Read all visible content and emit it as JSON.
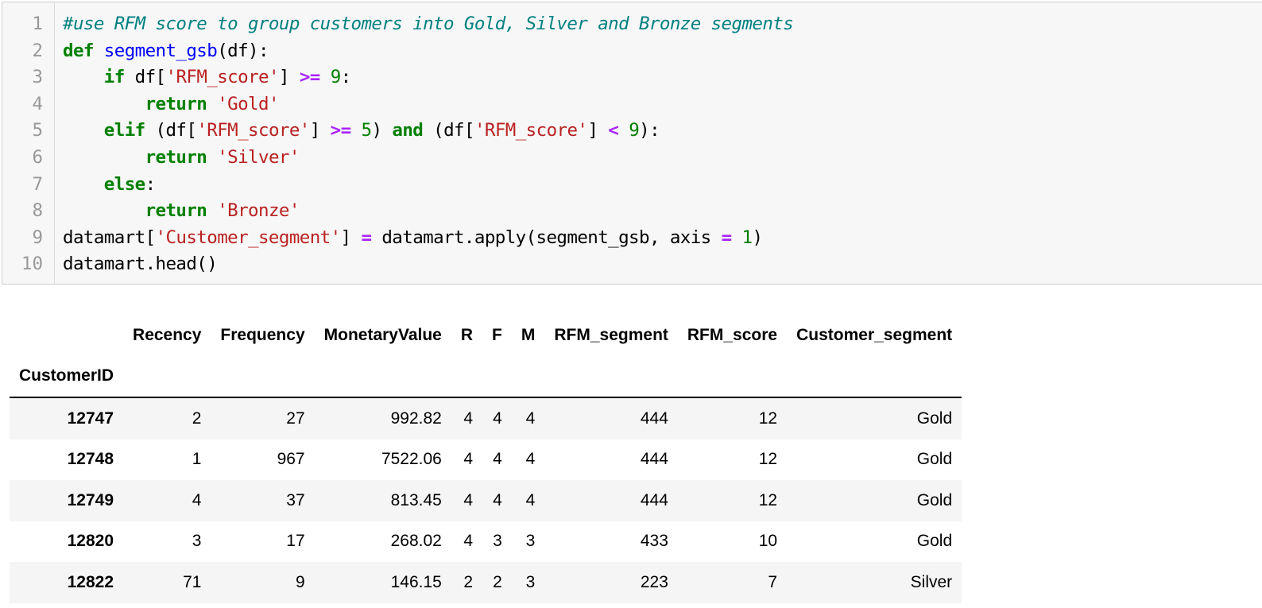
{
  "code_cell": {
    "line_numbers": [
      "1",
      "2",
      "3",
      "4",
      "5",
      "6",
      "7",
      "8",
      "9",
      "10"
    ],
    "lines": [
      [
        {
          "t": "cm",
          "v": "#use RFM score to group customers into Gold, Silver and Bronze segments"
        }
      ],
      [
        {
          "t": "kw",
          "v": "def"
        },
        {
          "t": "",
          "v": " "
        },
        {
          "t": "fn",
          "v": "segment_gsb"
        },
        {
          "t": "",
          "v": "(df):"
        }
      ],
      [
        {
          "t": "",
          "v": "    "
        },
        {
          "t": "kw",
          "v": "if"
        },
        {
          "t": "",
          "v": " df["
        },
        {
          "t": "st",
          "v": "'RFM_score'"
        },
        {
          "t": "",
          "v": "] "
        },
        {
          "t": "op",
          "v": ">="
        },
        {
          "t": "",
          "v": " "
        },
        {
          "t": "nu",
          "v": "9"
        },
        {
          "t": "",
          "v": ":"
        }
      ],
      [
        {
          "t": "",
          "v": "        "
        },
        {
          "t": "kw",
          "v": "return"
        },
        {
          "t": "",
          "v": " "
        },
        {
          "t": "st",
          "v": "'Gold'"
        }
      ],
      [
        {
          "t": "",
          "v": "    "
        },
        {
          "t": "kw",
          "v": "elif"
        },
        {
          "t": "",
          "v": " (df["
        },
        {
          "t": "st",
          "v": "'RFM_score'"
        },
        {
          "t": "",
          "v": "] "
        },
        {
          "t": "op",
          "v": ">="
        },
        {
          "t": "",
          "v": " "
        },
        {
          "t": "nu",
          "v": "5"
        },
        {
          "t": "",
          "v": ") "
        },
        {
          "t": "kw",
          "v": "and"
        },
        {
          "t": "",
          "v": " (df["
        },
        {
          "t": "st",
          "v": "'RFM_score'"
        },
        {
          "t": "",
          "v": "] "
        },
        {
          "t": "op",
          "v": "<"
        },
        {
          "t": "",
          "v": " "
        },
        {
          "t": "nu",
          "v": "9"
        },
        {
          "t": "",
          "v": "):"
        }
      ],
      [
        {
          "t": "",
          "v": "        "
        },
        {
          "t": "kw",
          "v": "return"
        },
        {
          "t": "",
          "v": " "
        },
        {
          "t": "st",
          "v": "'Silver'"
        }
      ],
      [
        {
          "t": "",
          "v": "    "
        },
        {
          "t": "kw",
          "v": "else"
        },
        {
          "t": "",
          "v": ":"
        }
      ],
      [
        {
          "t": "",
          "v": "        "
        },
        {
          "t": "kw",
          "v": "return"
        },
        {
          "t": "",
          "v": " "
        },
        {
          "t": "st",
          "v": "'Bronze'"
        }
      ],
      [
        {
          "t": "",
          "v": "datamart["
        },
        {
          "t": "st",
          "v": "'Customer_segment'"
        },
        {
          "t": "",
          "v": "] "
        },
        {
          "t": "op",
          "v": "="
        },
        {
          "t": "",
          "v": " datamart.apply(segment_gsb, axis "
        },
        {
          "t": "op",
          "v": "="
        },
        {
          "t": "",
          "v": " "
        },
        {
          "t": "nu",
          "v": "1"
        },
        {
          "t": "",
          "v": ")"
        }
      ],
      [
        {
          "t": "",
          "v": "datamart.head()"
        }
      ]
    ]
  },
  "dataframe": {
    "index_name": "CustomerID",
    "columns": [
      "Recency",
      "Frequency",
      "MonetaryValue",
      "R",
      "F",
      "M",
      "RFM_segment",
      "RFM_score",
      "Customer_segment"
    ],
    "rows": [
      {
        "index": "12747",
        "values": [
          "2",
          "27",
          "992.82",
          "4",
          "4",
          "4",
          "444",
          "12",
          "Gold"
        ]
      },
      {
        "index": "12748",
        "values": [
          "1",
          "967",
          "7522.06",
          "4",
          "4",
          "4",
          "444",
          "12",
          "Gold"
        ]
      },
      {
        "index": "12749",
        "values": [
          "4",
          "37",
          "813.45",
          "4",
          "4",
          "4",
          "444",
          "12",
          "Gold"
        ]
      },
      {
        "index": "12820",
        "values": [
          "3",
          "17",
          "268.02",
          "4",
          "3",
          "3",
          "433",
          "10",
          "Gold"
        ]
      },
      {
        "index": "12822",
        "values": [
          "71",
          "9",
          "146.15",
          "2",
          "2",
          "3",
          "223",
          "7",
          "Silver"
        ]
      }
    ]
  }
}
